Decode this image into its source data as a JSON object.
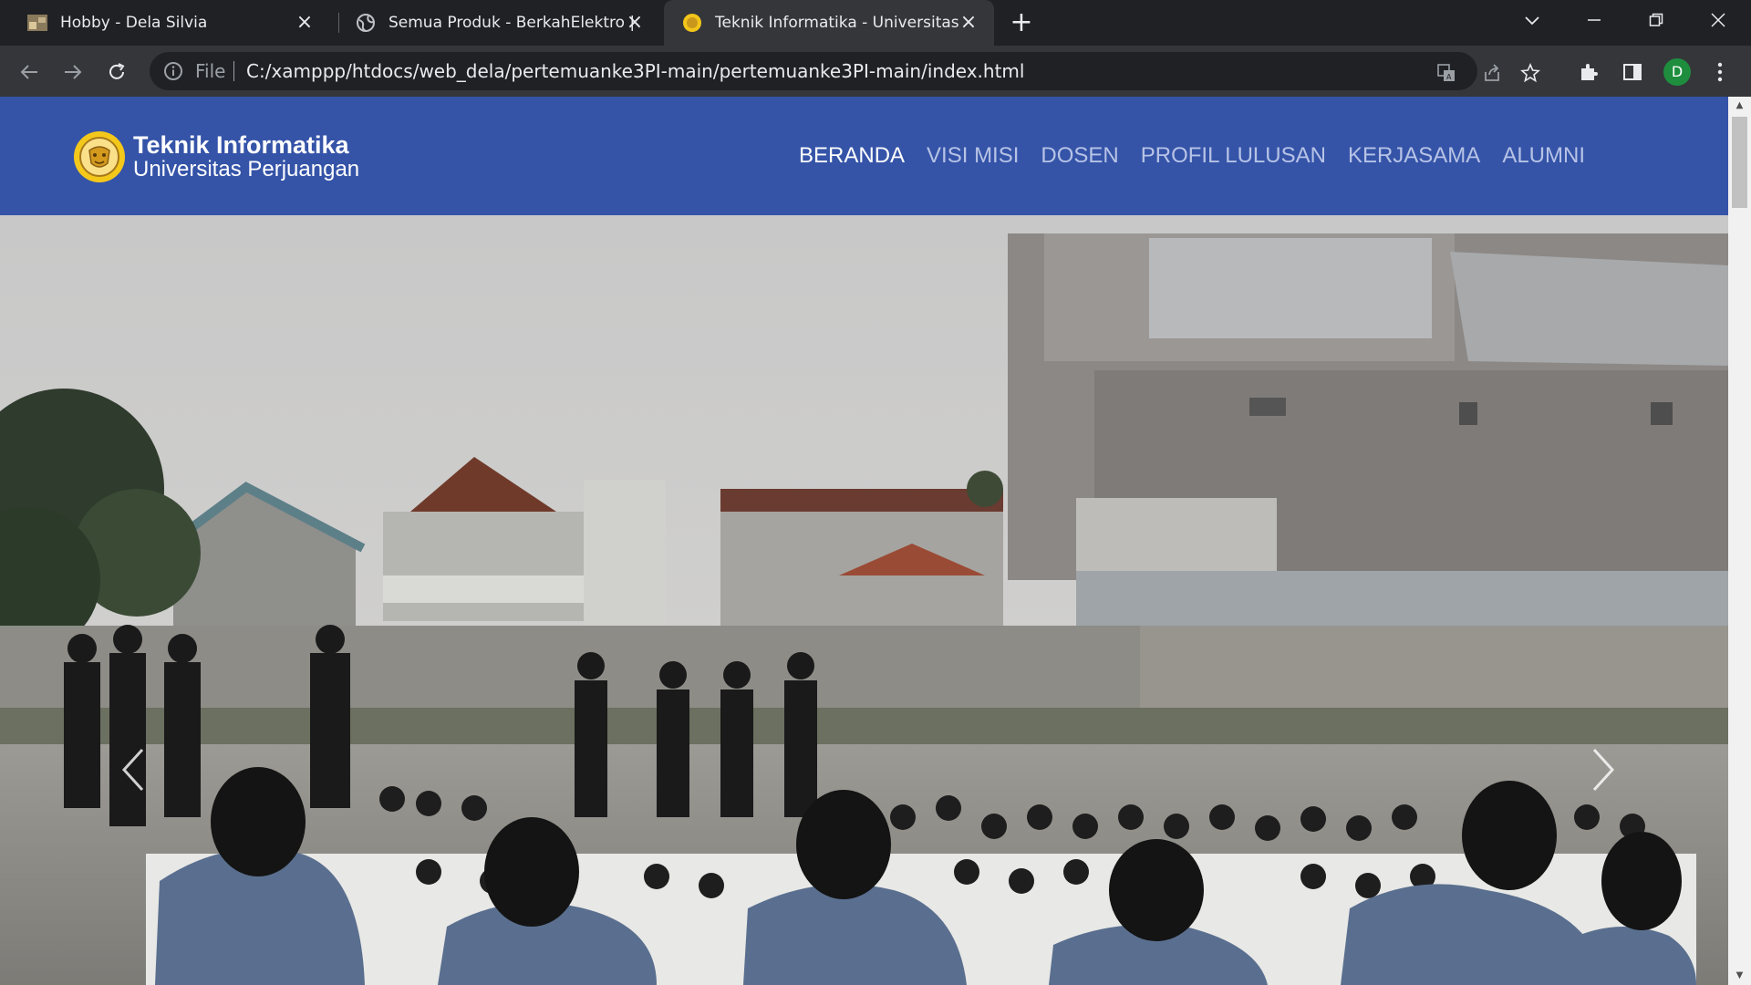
{
  "browser": {
    "tabs": [
      {
        "title": "Hobby - Dela Silvia",
        "favicon": "photo-favicon"
      },
      {
        "title": "Semua Produk - BerkahElektro | B",
        "favicon": "globe-icon"
      },
      {
        "title": "Teknik Informatika - Universitas P",
        "favicon": "unper-favicon",
        "active": true
      }
    ],
    "new_tab": "+",
    "address": {
      "scheme_label": "File",
      "url": "C:/xamppp/htdocs/web_dela/pertemuanke3PI-main/pertemuanke3PI-main/index.html"
    },
    "profile_initial": "D"
  },
  "site": {
    "brand_title": "Teknik Informatika",
    "brand_subtitle": "Universitas Perjuangan",
    "nav": [
      {
        "label": "BERANDA",
        "active": true
      },
      {
        "label": "VISI MISI"
      },
      {
        "label": "DOSEN"
      },
      {
        "label": "PROFIL LULUSAN"
      },
      {
        "label": "KERJASAMA"
      },
      {
        "label": "ALUMNI"
      }
    ],
    "colors": {
      "navbar": "#3554a8",
      "nav_active": "#ffffff",
      "nav_inactive": "#b7c3e6"
    }
  }
}
